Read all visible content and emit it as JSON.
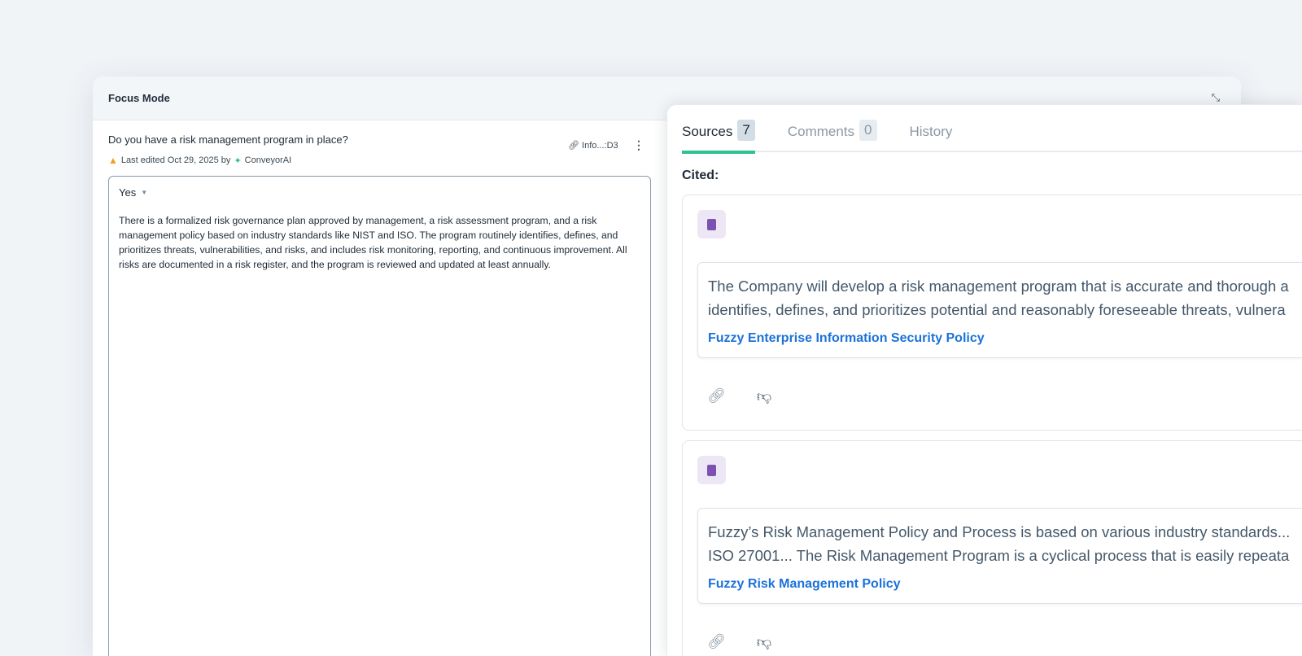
{
  "window": {
    "title": "Focus Mode",
    "collapse_icon": "collapse-icon"
  },
  "question": {
    "text": "Do you have a risk management program in place?",
    "meta_prefix": "Last edited Oct 29, 2025 by",
    "editor": "ConveyorAI",
    "ref": "Info...:D3"
  },
  "answer": {
    "choice": "Yes",
    "text": "There is a formalized risk governance plan approved by management, a risk assessment program, and a risk management policy based on industry standards like NIST and ISO. The program routinely identifies, defines, and prioritizes threats, vulnerabilities, and risks, and includes risk monitoring, reporting, and continuous improvement. All risks are documented in a risk register, and the program is reviewed and updated at least annually."
  },
  "tabs": [
    {
      "label": "Sources",
      "count": "7"
    },
    {
      "label": "Comments",
      "count": "0"
    },
    {
      "label": "History"
    }
  ],
  "cited_label": "Cited:",
  "sources": [
    {
      "line1": "The Company will develop a risk management program that is accurate and thorough a",
      "line2": "identifies, defines, and prioritizes potential and reasonably foreseeable threats, vulnera",
      "title": "Fuzzy Enterprise Information Security Policy"
    },
    {
      "line1": "Fuzzy’s Risk Management Policy and Process is based on various industry standards...",
      "line2": "ISO 27001... The Risk Management Program is a cyclical process that is easily repeata",
      "title": "Fuzzy Risk Management Policy"
    }
  ],
  "colors": {
    "accent": "#2ec28f",
    "link": "#1b72d8",
    "book": "#7b52b0"
  }
}
